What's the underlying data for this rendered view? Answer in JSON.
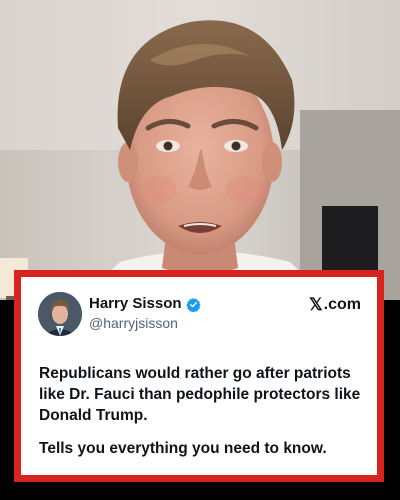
{
  "tweet": {
    "display_name": "Harry Sisson",
    "handle": "@harryjsisson",
    "source": ".com",
    "source_logo": "𝕏",
    "paragraph_1": "Republicans would rather go after patriots like Dr. Fauci than pedophile protectors like Donald Trump.",
    "paragraph_2": "Tells you everything you need to know."
  },
  "icons": {
    "verified": "verified-badge-icon",
    "logo": "x-logo-icon"
  },
  "colors": {
    "frame_border": "#d9231f",
    "verified_blue": "#1d9bf0",
    "text_primary": "#0f1419",
    "text_secondary": "#536471"
  }
}
